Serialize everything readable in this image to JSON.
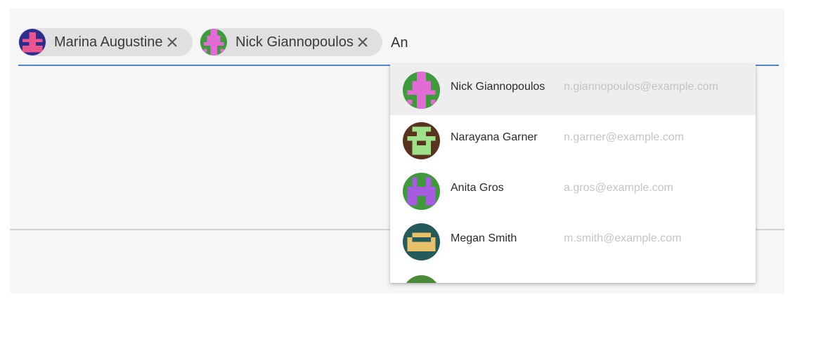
{
  "chips": [
    {
      "label": "Marina Augustine",
      "avatar_icon": "pixel-avatar-icon",
      "remove_icon": "close-icon"
    },
    {
      "label": "Nick Giannopoulos",
      "avatar_icon": "pixel-avatar-icon",
      "remove_icon": "close-icon"
    }
  ],
  "input": {
    "value": "An"
  },
  "suggestions": [
    {
      "name": "Nick Giannopoulos",
      "email": "n.giannopoulos@example.com",
      "highlighted": true
    },
    {
      "name": "Narayana Garner",
      "email": "n.garner@example.com",
      "highlighted": false
    },
    {
      "name": "Anita Gros",
      "email": "a.gros@example.com",
      "highlighted": false
    },
    {
      "name": "Megan Smith",
      "email": "m.smith@example.com",
      "highlighted": false
    }
  ],
  "colors": {
    "accent_underline": "#4f86c6",
    "chip_background": "#e0e0e0",
    "highlight_row": "#eeeeee",
    "email_text": "#c4c4c4"
  }
}
